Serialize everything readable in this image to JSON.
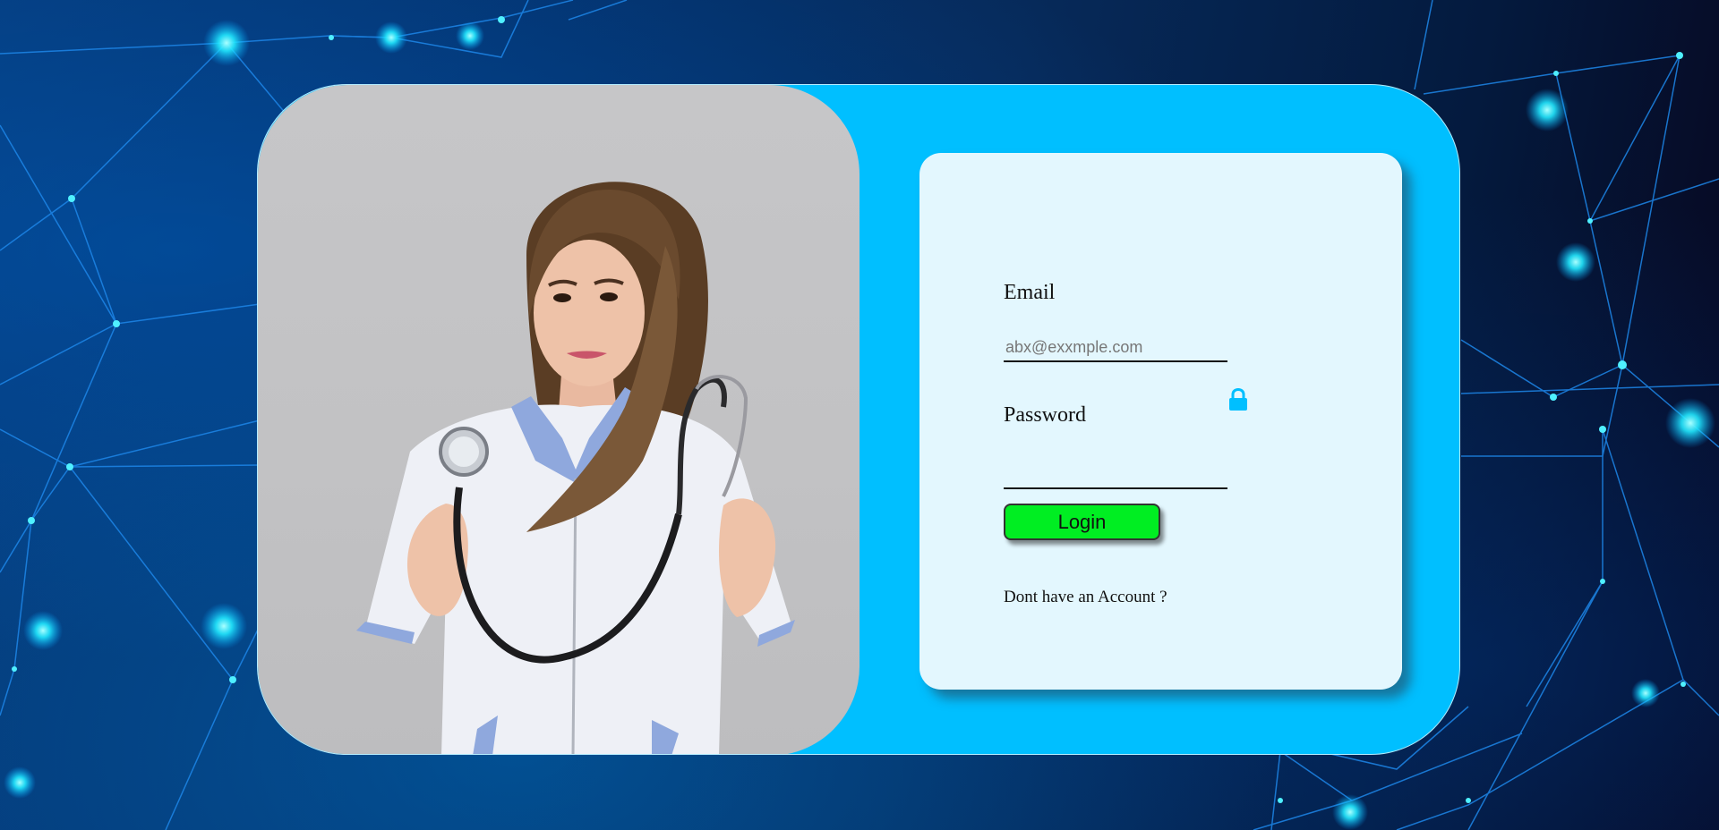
{
  "login_form": {
    "email_label": "Email",
    "email_placeholder": "abx@exxmple.com",
    "email_value": "",
    "password_label": "Password",
    "password_value": "",
    "lock_icon": "lock-icon",
    "login_label": "Login",
    "signup_text": "Dont have an Account ?"
  },
  "colors": {
    "card_background": "#00bfff",
    "form_background": "#e3f7fe",
    "login_button": "#00ee22",
    "lock_icon": "#00bfff"
  }
}
